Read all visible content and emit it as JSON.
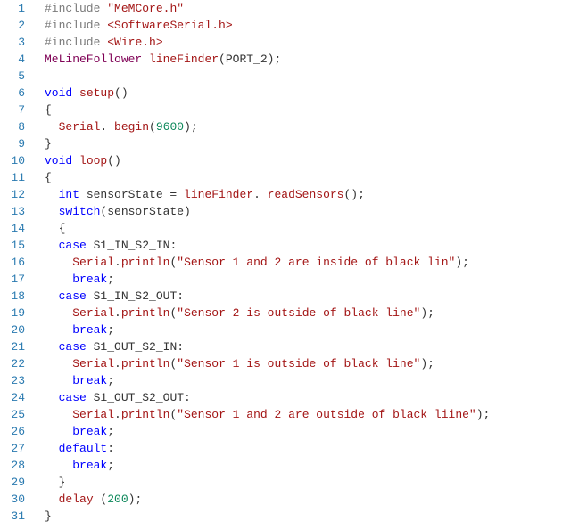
{
  "line_numbers": [
    "1",
    "2",
    "3",
    "4",
    "5",
    "6",
    "7",
    "8",
    "9",
    "10",
    "11",
    "12",
    "13",
    "14",
    "15",
    "16",
    "17",
    "18",
    "19",
    "20",
    "21",
    "22",
    "23",
    "24",
    "25",
    "26",
    "27",
    "28",
    "29",
    "30",
    "31"
  ],
  "lines": [
    {
      "indent": 0,
      "tokens": [
        {
          "cls": "mac",
          "t": "#include"
        },
        {
          "cls": "punc",
          "t": " "
        },
        {
          "cls": "str",
          "t": "\"MeMCore.h\""
        }
      ]
    },
    {
      "indent": 0,
      "tokens": [
        {
          "cls": "mac",
          "t": "#include"
        },
        {
          "cls": "punc",
          "t": " "
        },
        {
          "cls": "str",
          "t": "<SoftwareSerial.h>"
        }
      ]
    },
    {
      "indent": 0,
      "tokens": [
        {
          "cls": "mac",
          "t": "#include"
        },
        {
          "cls": "punc",
          "t": " "
        },
        {
          "cls": "str",
          "t": "<Wire.h>"
        }
      ]
    },
    {
      "indent": 0,
      "tokens": [
        {
          "cls": "typ",
          "t": "MeLineFollower"
        },
        {
          "cls": "punc",
          "t": " "
        },
        {
          "cls": "ident",
          "t": "lineFinder"
        },
        {
          "cls": "punc",
          "t": "(PORT_2);"
        }
      ]
    },
    {
      "indent": 0,
      "tokens": []
    },
    {
      "indent": 0,
      "tokens": [
        {
          "cls": "kw",
          "t": "void"
        },
        {
          "cls": "punc",
          "t": " "
        },
        {
          "cls": "ident",
          "t": "setup"
        },
        {
          "cls": "punc",
          "t": "()"
        }
      ]
    },
    {
      "indent": 0,
      "tokens": [
        {
          "cls": "punc",
          "t": "{"
        }
      ]
    },
    {
      "indent": 1,
      "tokens": [
        {
          "cls": "ident",
          "t": "Serial"
        },
        {
          "cls": "punc",
          "t": ". "
        },
        {
          "cls": "ident",
          "t": "begin"
        },
        {
          "cls": "punc",
          "t": "("
        },
        {
          "cls": "num",
          "t": "9600"
        },
        {
          "cls": "punc",
          "t": ");"
        }
      ]
    },
    {
      "indent": 0,
      "tokens": [
        {
          "cls": "punc",
          "t": "}"
        }
      ]
    },
    {
      "indent": 0,
      "tokens": [
        {
          "cls": "kw",
          "t": "void"
        },
        {
          "cls": "punc",
          "t": " "
        },
        {
          "cls": "ident",
          "t": "loop"
        },
        {
          "cls": "punc",
          "t": "()"
        }
      ]
    },
    {
      "indent": 0,
      "tokens": [
        {
          "cls": "punc",
          "t": "{"
        }
      ]
    },
    {
      "indent": 1,
      "tokens": [
        {
          "cls": "kw",
          "t": "int"
        },
        {
          "cls": "punc",
          "t": " sensorState = "
        },
        {
          "cls": "ident",
          "t": "lineFinder"
        },
        {
          "cls": "punc",
          "t": ". "
        },
        {
          "cls": "ident",
          "t": "readSensors"
        },
        {
          "cls": "punc",
          "t": "();"
        }
      ]
    },
    {
      "indent": 1,
      "tokens": [
        {
          "cls": "kw",
          "t": "switch"
        },
        {
          "cls": "punc",
          "t": "(sensorState)"
        }
      ]
    },
    {
      "indent": 1,
      "tokens": [
        {
          "cls": "punc",
          "t": "{"
        }
      ]
    },
    {
      "indent": 1,
      "tokens": [
        {
          "cls": "kw",
          "t": "case"
        },
        {
          "cls": "punc",
          "t": " S1_IN_S2_IN:"
        }
      ]
    },
    {
      "indent": 2,
      "tokens": [
        {
          "cls": "ident",
          "t": "Serial"
        },
        {
          "cls": "punc",
          "t": "."
        },
        {
          "cls": "ident",
          "t": "println"
        },
        {
          "cls": "punc",
          "t": "("
        },
        {
          "cls": "str",
          "t": "\"Sensor 1 and 2 are inside of black lin\""
        },
        {
          "cls": "punc",
          "t": ");"
        }
      ]
    },
    {
      "indent": 2,
      "tokens": [
        {
          "cls": "kw",
          "t": "break"
        },
        {
          "cls": "punc",
          "t": ";"
        }
      ]
    },
    {
      "indent": 1,
      "tokens": [
        {
          "cls": "kw",
          "t": "case"
        },
        {
          "cls": "punc",
          "t": " S1_IN_S2_OUT:"
        }
      ]
    },
    {
      "indent": 2,
      "tokens": [
        {
          "cls": "ident",
          "t": "Serial"
        },
        {
          "cls": "punc",
          "t": "."
        },
        {
          "cls": "ident",
          "t": "println"
        },
        {
          "cls": "punc",
          "t": "("
        },
        {
          "cls": "str",
          "t": "\"Sensor 2 is outside of black line\""
        },
        {
          "cls": "punc",
          "t": ");"
        }
      ]
    },
    {
      "indent": 2,
      "tokens": [
        {
          "cls": "kw",
          "t": "break"
        },
        {
          "cls": "punc",
          "t": ";"
        }
      ]
    },
    {
      "indent": 1,
      "tokens": [
        {
          "cls": "kw",
          "t": "case"
        },
        {
          "cls": "punc",
          "t": " S1_OUT_S2_IN:"
        }
      ]
    },
    {
      "indent": 2,
      "tokens": [
        {
          "cls": "ident",
          "t": "Serial"
        },
        {
          "cls": "punc",
          "t": "."
        },
        {
          "cls": "ident",
          "t": "println"
        },
        {
          "cls": "punc",
          "t": "("
        },
        {
          "cls": "str",
          "t": "\"Sensor 1 is outside of black line\""
        },
        {
          "cls": "punc",
          "t": ");"
        }
      ]
    },
    {
      "indent": 2,
      "tokens": [
        {
          "cls": "kw",
          "t": "break"
        },
        {
          "cls": "punc",
          "t": ";"
        }
      ]
    },
    {
      "indent": 1,
      "tokens": [
        {
          "cls": "kw",
          "t": "case"
        },
        {
          "cls": "punc",
          "t": " S1_OUT_S2_OUT:"
        }
      ]
    },
    {
      "indent": 2,
      "tokens": [
        {
          "cls": "ident",
          "t": "Serial"
        },
        {
          "cls": "punc",
          "t": "."
        },
        {
          "cls": "ident",
          "t": "println"
        },
        {
          "cls": "punc",
          "t": "("
        },
        {
          "cls": "str",
          "t": "\"Sensor 1 and 2 are outside of black liine\""
        },
        {
          "cls": "punc",
          "t": ");"
        }
      ]
    },
    {
      "indent": 2,
      "tokens": [
        {
          "cls": "kw",
          "t": "break"
        },
        {
          "cls": "punc",
          "t": ";"
        }
      ]
    },
    {
      "indent": 1,
      "tokens": [
        {
          "cls": "kw",
          "t": "default"
        },
        {
          "cls": "punc",
          "t": ":"
        }
      ]
    },
    {
      "indent": 2,
      "tokens": [
        {
          "cls": "kw",
          "t": "break"
        },
        {
          "cls": "punc",
          "t": ";"
        }
      ]
    },
    {
      "indent": 1,
      "tokens": [
        {
          "cls": "punc",
          "t": "}"
        }
      ]
    },
    {
      "indent": 1,
      "tokens": [
        {
          "cls": "ident",
          "t": "delay"
        },
        {
          "cls": "punc",
          "t": " ("
        },
        {
          "cls": "num",
          "t": "200"
        },
        {
          "cls": "punc",
          "t": ");"
        }
      ]
    },
    {
      "indent": 0,
      "tokens": [
        {
          "cls": "punc",
          "t": "}"
        }
      ]
    }
  ]
}
